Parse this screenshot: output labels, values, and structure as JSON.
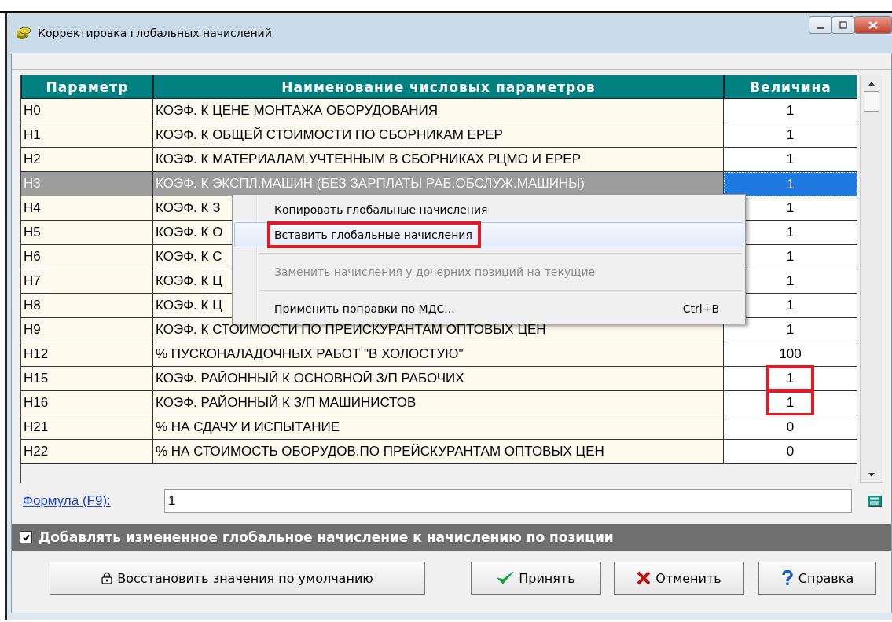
{
  "window": {
    "title": "Корректировка глобальных начислений"
  },
  "table": {
    "columns": [
      "Параметр",
      "Наименование числовых параметров",
      "Величина"
    ],
    "rows": [
      {
        "param": "Н0",
        "name": "КОЭФ. К ЦЕНЕ МОНТАЖА ОБОРУДОВАНИЯ",
        "value": "1",
        "selected": false,
        "highlighted": false
      },
      {
        "param": "Н1",
        "name": "КОЭФ. К ОБЩЕЙ СТОИМОСТИ ПО СБОРНИКАМ ЕРЕР",
        "value": "1",
        "selected": false,
        "highlighted": false
      },
      {
        "param": "Н2",
        "name": "КОЭФ. К МАТЕРИАЛАМ,УЧТЕННЫМ В СБОРНИКАХ РЦМО И ЕРЕР",
        "value": "1",
        "selected": false,
        "highlighted": false
      },
      {
        "param": "Н3",
        "name": "КОЭФ. К ЭКСПЛ.МАШИН (БЕЗ ЗАРПЛАТЫ РАБ.ОБСЛУЖ.МАШИНЫ)",
        "value": "1",
        "selected": true,
        "highlighted": false
      },
      {
        "param": "Н4",
        "name": "КОЭФ. К З",
        "value": "1",
        "selected": false,
        "highlighted": false
      },
      {
        "param": "Н5",
        "name": "КОЭФ. К О",
        "value": "1",
        "selected": false,
        "highlighted": false
      },
      {
        "param": "Н6",
        "name": "КОЭФ. К С",
        "value": "1",
        "selected": false,
        "highlighted": false
      },
      {
        "param": "Н7",
        "name": "КОЭФ. К Ц",
        "value": "1",
        "selected": false,
        "highlighted": false
      },
      {
        "param": "Н8",
        "name": "КОЭФ. К Ц",
        "value": "1",
        "selected": false,
        "highlighted": false
      },
      {
        "param": "Н9",
        "name": "КОЭФ. К СТОИМОСТИ ПО ПРЕЙСКУРАНТАМ ОПТОВЫХ ЦЕН",
        "value": "1",
        "selected": false,
        "highlighted": false
      },
      {
        "param": "Н12",
        "name": "% ПУСКОНАЛАДОЧНЫХ РАБОТ \"В ХОЛОСТУЮ\"",
        "value": "100",
        "selected": false,
        "highlighted": false
      },
      {
        "param": "Н15",
        "name": "КОЭФ. РАЙОННЫЙ К ОСНОВНОЙ З/П РАБОЧИХ",
        "value": "1",
        "selected": false,
        "highlighted": true
      },
      {
        "param": "Н16",
        "name": "КОЭФ. РАЙОННЫЙ К З/П МАШИНИСТОВ",
        "value": "1",
        "selected": false,
        "highlighted": true
      },
      {
        "param": "Н21",
        "name": "% НА СДАЧУ И ИСПЫТАНИЕ",
        "value": "0",
        "selected": false,
        "highlighted": false
      },
      {
        "param": "Н22",
        "name": "% НА СТОИМОСТЬ ОБОРУДОВ.ПО ПРЕЙСКУРАНТАМ ОПТОВЫХ ЦЕН",
        "value": "0",
        "selected": false,
        "highlighted": false
      }
    ]
  },
  "context_menu": {
    "items": [
      {
        "kind": "item",
        "label": "Копировать глобальные начисления",
        "disabled": false,
        "selected": false,
        "highlighted": false
      },
      {
        "kind": "item",
        "label": "Вставить глобальные начисления",
        "disabled": false,
        "selected": true,
        "highlighted": true
      },
      {
        "kind": "separator"
      },
      {
        "kind": "item",
        "label": "Заменить начисления у дочерних позиций на текущие",
        "disabled": true,
        "selected": false,
        "highlighted": false
      },
      {
        "kind": "separator"
      },
      {
        "kind": "item",
        "label": "Применить поправки по МДС...",
        "shortcut": "Ctrl+B",
        "disabled": false,
        "selected": false,
        "highlighted": false
      }
    ]
  },
  "formula": {
    "label": "Формула (F9):",
    "value": "1"
  },
  "option": {
    "label": "Добавлять измененное глобальное начисление к начислению по позиции",
    "checked": true
  },
  "buttons": [
    {
      "kind": "restore",
      "label": "Восстановить значения по умолчанию"
    },
    {
      "kind": "ok",
      "label": "Принять"
    },
    {
      "kind": "cancel",
      "label": "Отменить"
    },
    {
      "kind": "help",
      "label": "Справка"
    }
  ]
}
